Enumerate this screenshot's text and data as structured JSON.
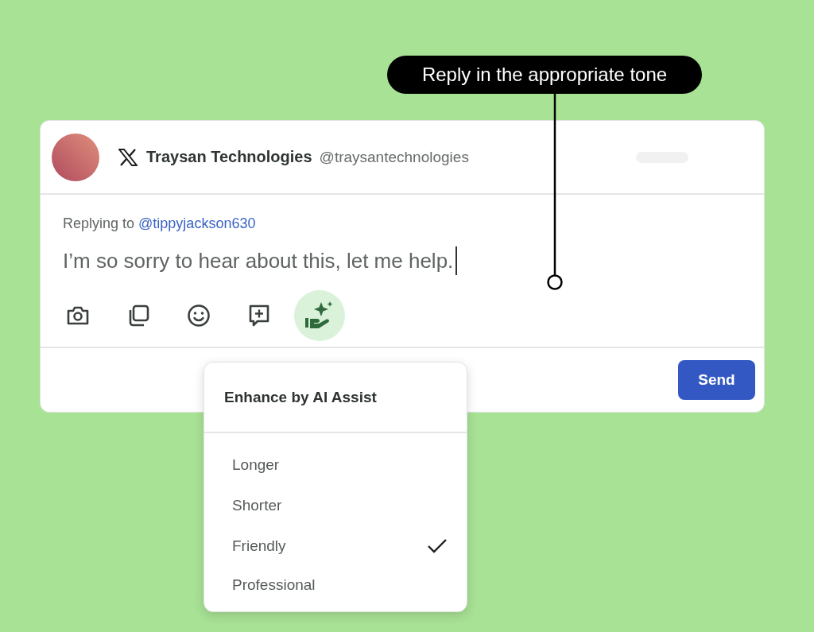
{
  "callout": {
    "text": "Reply in the appropriate tone"
  },
  "post": {
    "account_name": "Traysan Technologies",
    "handle": "@traysantechnologies"
  },
  "reply": {
    "replying_to_label": "Replying to",
    "replying_to_handle": "@tippyjackson630",
    "text": "I’m so sorry to hear about this, let me help."
  },
  "toolbar": [
    {
      "kind": "camera",
      "selected": false
    },
    {
      "kind": "gallery",
      "selected": false
    },
    {
      "kind": "emoji",
      "selected": false
    },
    {
      "kind": "add-comment",
      "selected": false
    },
    {
      "kind": "ai-assist",
      "selected": true
    }
  ],
  "send_button": "Send",
  "menu": {
    "title": "Enhance by AI Assist",
    "items": [
      {
        "label": "Longer",
        "checked": false
      },
      {
        "label": "Shorter",
        "checked": false
      },
      {
        "label": "Friendly",
        "checked": true
      },
      {
        "label": "Professional",
        "checked": false
      }
    ]
  }
}
